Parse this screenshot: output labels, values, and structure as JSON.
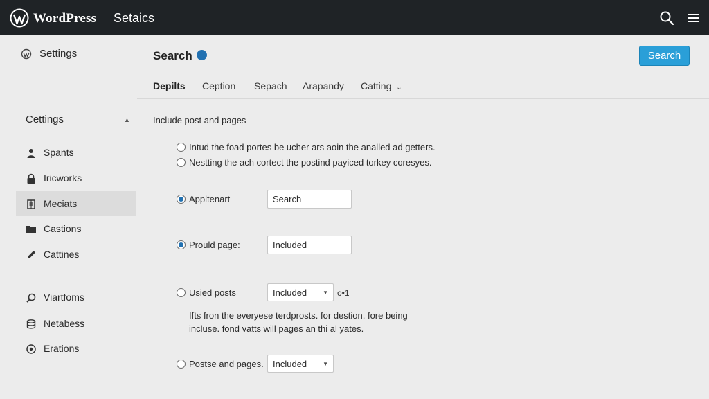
{
  "topbar": {
    "brand": "WordPress",
    "title": "Setaics",
    "icons": [
      "wordpress-logo",
      "search-icon",
      "menu-icon"
    ]
  },
  "sidebar": {
    "top_item": {
      "label": "Settings",
      "icon": "wordpress-icon"
    },
    "section": {
      "label": "Cettings",
      "icon": "caret-up-icon"
    },
    "items": [
      {
        "label": "Spants",
        "icon": "user-icon"
      },
      {
        "label": "Iricworks",
        "icon": "lock-icon"
      },
      {
        "label": "Meciats",
        "icon": "media-icon",
        "active": true
      },
      {
        "label": "Castions",
        "icon": "folder-icon"
      },
      {
        "label": "Cattines",
        "icon": "pencil-icon"
      },
      {
        "label": "Viartfoms",
        "icon": "tools-icon"
      },
      {
        "label": "Netabess",
        "icon": "database-icon"
      },
      {
        "label": "Erations",
        "icon": "circle-icon"
      }
    ]
  },
  "main": {
    "title": "Search",
    "primary_button": "Search",
    "tabs": [
      {
        "label": "Depilts",
        "active": true
      },
      {
        "label": "Ception"
      },
      {
        "label": "Sepach"
      },
      {
        "label": "Arapandy"
      },
      {
        "label": "Catting",
        "has_dropdown": true
      }
    ],
    "section_label": "Include post and pages",
    "options": [
      {
        "label": "Intud the foad portes be ucher ars aoin the analled ad getters.",
        "checked": false
      },
      {
        "label": "Nestting the ach cortect the postind payiced torkey coresyes.",
        "checked": false
      },
      {
        "label": "Appltenart",
        "checked": true,
        "control": "text",
        "value": "Search"
      },
      {
        "label": "Prould page:",
        "checked": true,
        "control": "text",
        "value": "Included"
      },
      {
        "label": "Usied posts",
        "checked": false,
        "control": "select",
        "value": "Included",
        "extra": "o•1"
      },
      {
        "label": "Postse and pages.",
        "checked": false,
        "control": "select",
        "value": "Included"
      }
    ],
    "description": "Ifts fron the everyese terdprosts. for destion, fore being incluse. fond vatts will pages an thi al yates.",
    "colors": {
      "accent": "#2a9fd8",
      "topbar": "#1f2326",
      "radio_checked": "#2271b1"
    }
  }
}
